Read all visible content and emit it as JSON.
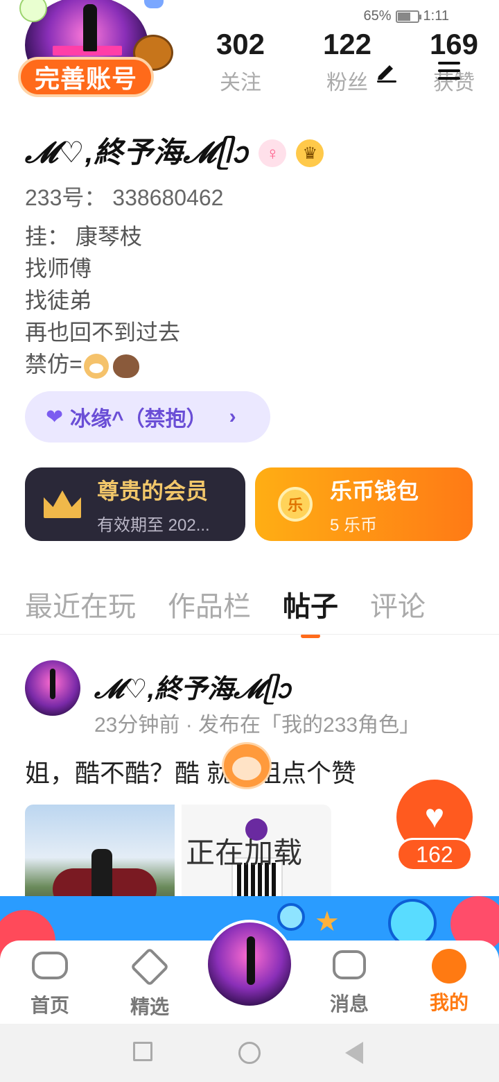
{
  "status_bar": {
    "battery_percent": "65%",
    "battery_level": 0.65,
    "time": "1:11"
  },
  "profile": {
    "complete_account_label": "完善账号",
    "stats": [
      {
        "value": "302",
        "label": "关注"
      },
      {
        "value": "122",
        "label": "粉丝"
      },
      {
        "value": "169",
        "label": "获赞"
      }
    ],
    "nickname": "𝓜♡,終予海𝓜ᥫᩣ",
    "gender_icon": "female-icon",
    "crown_icon": "crown-icon",
    "uid": "233号： 338680462",
    "bio": [
      "挂：  康琴枝",
      "找师傅",
      "找徒弟",
      "再也回不到过去",
      "禁仿="
    ],
    "guild": {
      "label": "冰缘^（禁抱）"
    }
  },
  "cards": {
    "vip": {
      "title": "尊贵的会员",
      "subtitle": "有效期至 202..."
    },
    "wallet": {
      "title": "乐币钱包",
      "subtitle": "5 乐币",
      "coin_glyph": "乐"
    }
  },
  "tabs": [
    {
      "label": "最近在玩",
      "active": false
    },
    {
      "label": "作品栏",
      "active": false
    },
    {
      "label": "帖子",
      "active": true
    },
    {
      "label": "评论",
      "active": false
    }
  ],
  "post": {
    "author": "𝓜♡,終予海𝓜ᥫᩣ",
    "meta": "23分钟前 · 发布在「我的233角色」",
    "text": "姐，酷不酷？酷  就给姐点个赞",
    "loading_text": "正在加载",
    "likes": "162"
  },
  "bottom_nav": [
    {
      "label": "首页",
      "icon": "gamepad-icon",
      "active": false
    },
    {
      "label": "精选",
      "icon": "heart-icon",
      "active": false
    },
    {
      "label": "消息",
      "icon": "chat-icon",
      "active": false
    },
    {
      "label": "我的",
      "icon": "profile-icon",
      "active": true
    }
  ],
  "colors": {
    "accent": "#ff6a1a",
    "vip_bg": "#2a2838",
    "guild_bg": "#ebe8ff",
    "guild_text": "#6a4ed6"
  }
}
